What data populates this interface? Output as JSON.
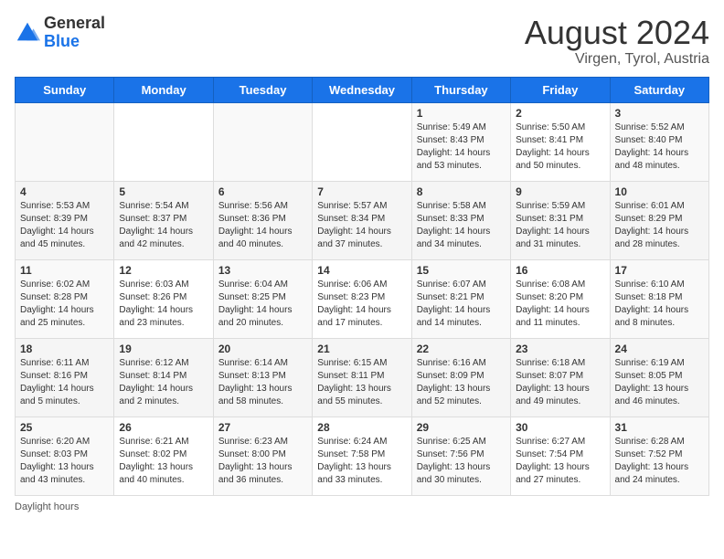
{
  "logo": {
    "general": "General",
    "blue": "Blue"
  },
  "header": {
    "title": "August 2024",
    "subtitle": "Virgen, Tyrol, Austria"
  },
  "days_of_week": [
    "Sunday",
    "Monday",
    "Tuesday",
    "Wednesday",
    "Thursday",
    "Friday",
    "Saturday"
  ],
  "footer": {
    "daylight_label": "Daylight hours"
  },
  "weeks": [
    {
      "days": [
        {
          "num": "",
          "info": ""
        },
        {
          "num": "",
          "info": ""
        },
        {
          "num": "",
          "info": ""
        },
        {
          "num": "",
          "info": ""
        },
        {
          "num": "1",
          "info": "Sunrise: 5:49 AM\nSunset: 8:43 PM\nDaylight: 14 hours\nand 53 minutes."
        },
        {
          "num": "2",
          "info": "Sunrise: 5:50 AM\nSunset: 8:41 PM\nDaylight: 14 hours\nand 50 minutes."
        },
        {
          "num": "3",
          "info": "Sunrise: 5:52 AM\nSunset: 8:40 PM\nDaylight: 14 hours\nand 48 minutes."
        }
      ]
    },
    {
      "days": [
        {
          "num": "4",
          "info": "Sunrise: 5:53 AM\nSunset: 8:39 PM\nDaylight: 14 hours\nand 45 minutes."
        },
        {
          "num": "5",
          "info": "Sunrise: 5:54 AM\nSunset: 8:37 PM\nDaylight: 14 hours\nand 42 minutes."
        },
        {
          "num": "6",
          "info": "Sunrise: 5:56 AM\nSunset: 8:36 PM\nDaylight: 14 hours\nand 40 minutes."
        },
        {
          "num": "7",
          "info": "Sunrise: 5:57 AM\nSunset: 8:34 PM\nDaylight: 14 hours\nand 37 minutes."
        },
        {
          "num": "8",
          "info": "Sunrise: 5:58 AM\nSunset: 8:33 PM\nDaylight: 14 hours\nand 34 minutes."
        },
        {
          "num": "9",
          "info": "Sunrise: 5:59 AM\nSunset: 8:31 PM\nDaylight: 14 hours\nand 31 minutes."
        },
        {
          "num": "10",
          "info": "Sunrise: 6:01 AM\nSunset: 8:29 PM\nDaylight: 14 hours\nand 28 minutes."
        }
      ]
    },
    {
      "days": [
        {
          "num": "11",
          "info": "Sunrise: 6:02 AM\nSunset: 8:28 PM\nDaylight: 14 hours\nand 25 minutes."
        },
        {
          "num": "12",
          "info": "Sunrise: 6:03 AM\nSunset: 8:26 PM\nDaylight: 14 hours\nand 23 minutes."
        },
        {
          "num": "13",
          "info": "Sunrise: 6:04 AM\nSunset: 8:25 PM\nDaylight: 14 hours\nand 20 minutes."
        },
        {
          "num": "14",
          "info": "Sunrise: 6:06 AM\nSunset: 8:23 PM\nDaylight: 14 hours\nand 17 minutes."
        },
        {
          "num": "15",
          "info": "Sunrise: 6:07 AM\nSunset: 8:21 PM\nDaylight: 14 hours\nand 14 minutes."
        },
        {
          "num": "16",
          "info": "Sunrise: 6:08 AM\nSunset: 8:20 PM\nDaylight: 14 hours\nand 11 minutes."
        },
        {
          "num": "17",
          "info": "Sunrise: 6:10 AM\nSunset: 8:18 PM\nDaylight: 14 hours\nand 8 minutes."
        }
      ]
    },
    {
      "days": [
        {
          "num": "18",
          "info": "Sunrise: 6:11 AM\nSunset: 8:16 PM\nDaylight: 14 hours\nand 5 minutes."
        },
        {
          "num": "19",
          "info": "Sunrise: 6:12 AM\nSunset: 8:14 PM\nDaylight: 14 hours\nand 2 minutes."
        },
        {
          "num": "20",
          "info": "Sunrise: 6:14 AM\nSunset: 8:13 PM\nDaylight: 13 hours\nand 58 minutes."
        },
        {
          "num": "21",
          "info": "Sunrise: 6:15 AM\nSunset: 8:11 PM\nDaylight: 13 hours\nand 55 minutes."
        },
        {
          "num": "22",
          "info": "Sunrise: 6:16 AM\nSunset: 8:09 PM\nDaylight: 13 hours\nand 52 minutes."
        },
        {
          "num": "23",
          "info": "Sunrise: 6:18 AM\nSunset: 8:07 PM\nDaylight: 13 hours\nand 49 minutes."
        },
        {
          "num": "24",
          "info": "Sunrise: 6:19 AM\nSunset: 8:05 PM\nDaylight: 13 hours\nand 46 minutes."
        }
      ]
    },
    {
      "days": [
        {
          "num": "25",
          "info": "Sunrise: 6:20 AM\nSunset: 8:03 PM\nDaylight: 13 hours\nand 43 minutes."
        },
        {
          "num": "26",
          "info": "Sunrise: 6:21 AM\nSunset: 8:02 PM\nDaylight: 13 hours\nand 40 minutes."
        },
        {
          "num": "27",
          "info": "Sunrise: 6:23 AM\nSunset: 8:00 PM\nDaylight: 13 hours\nand 36 minutes."
        },
        {
          "num": "28",
          "info": "Sunrise: 6:24 AM\nSunset: 7:58 PM\nDaylight: 13 hours\nand 33 minutes."
        },
        {
          "num": "29",
          "info": "Sunrise: 6:25 AM\nSunset: 7:56 PM\nDaylight: 13 hours\nand 30 minutes."
        },
        {
          "num": "30",
          "info": "Sunrise: 6:27 AM\nSunset: 7:54 PM\nDaylight: 13 hours\nand 27 minutes."
        },
        {
          "num": "31",
          "info": "Sunrise: 6:28 AM\nSunset: 7:52 PM\nDaylight: 13 hours\nand 24 minutes."
        }
      ]
    }
  ]
}
